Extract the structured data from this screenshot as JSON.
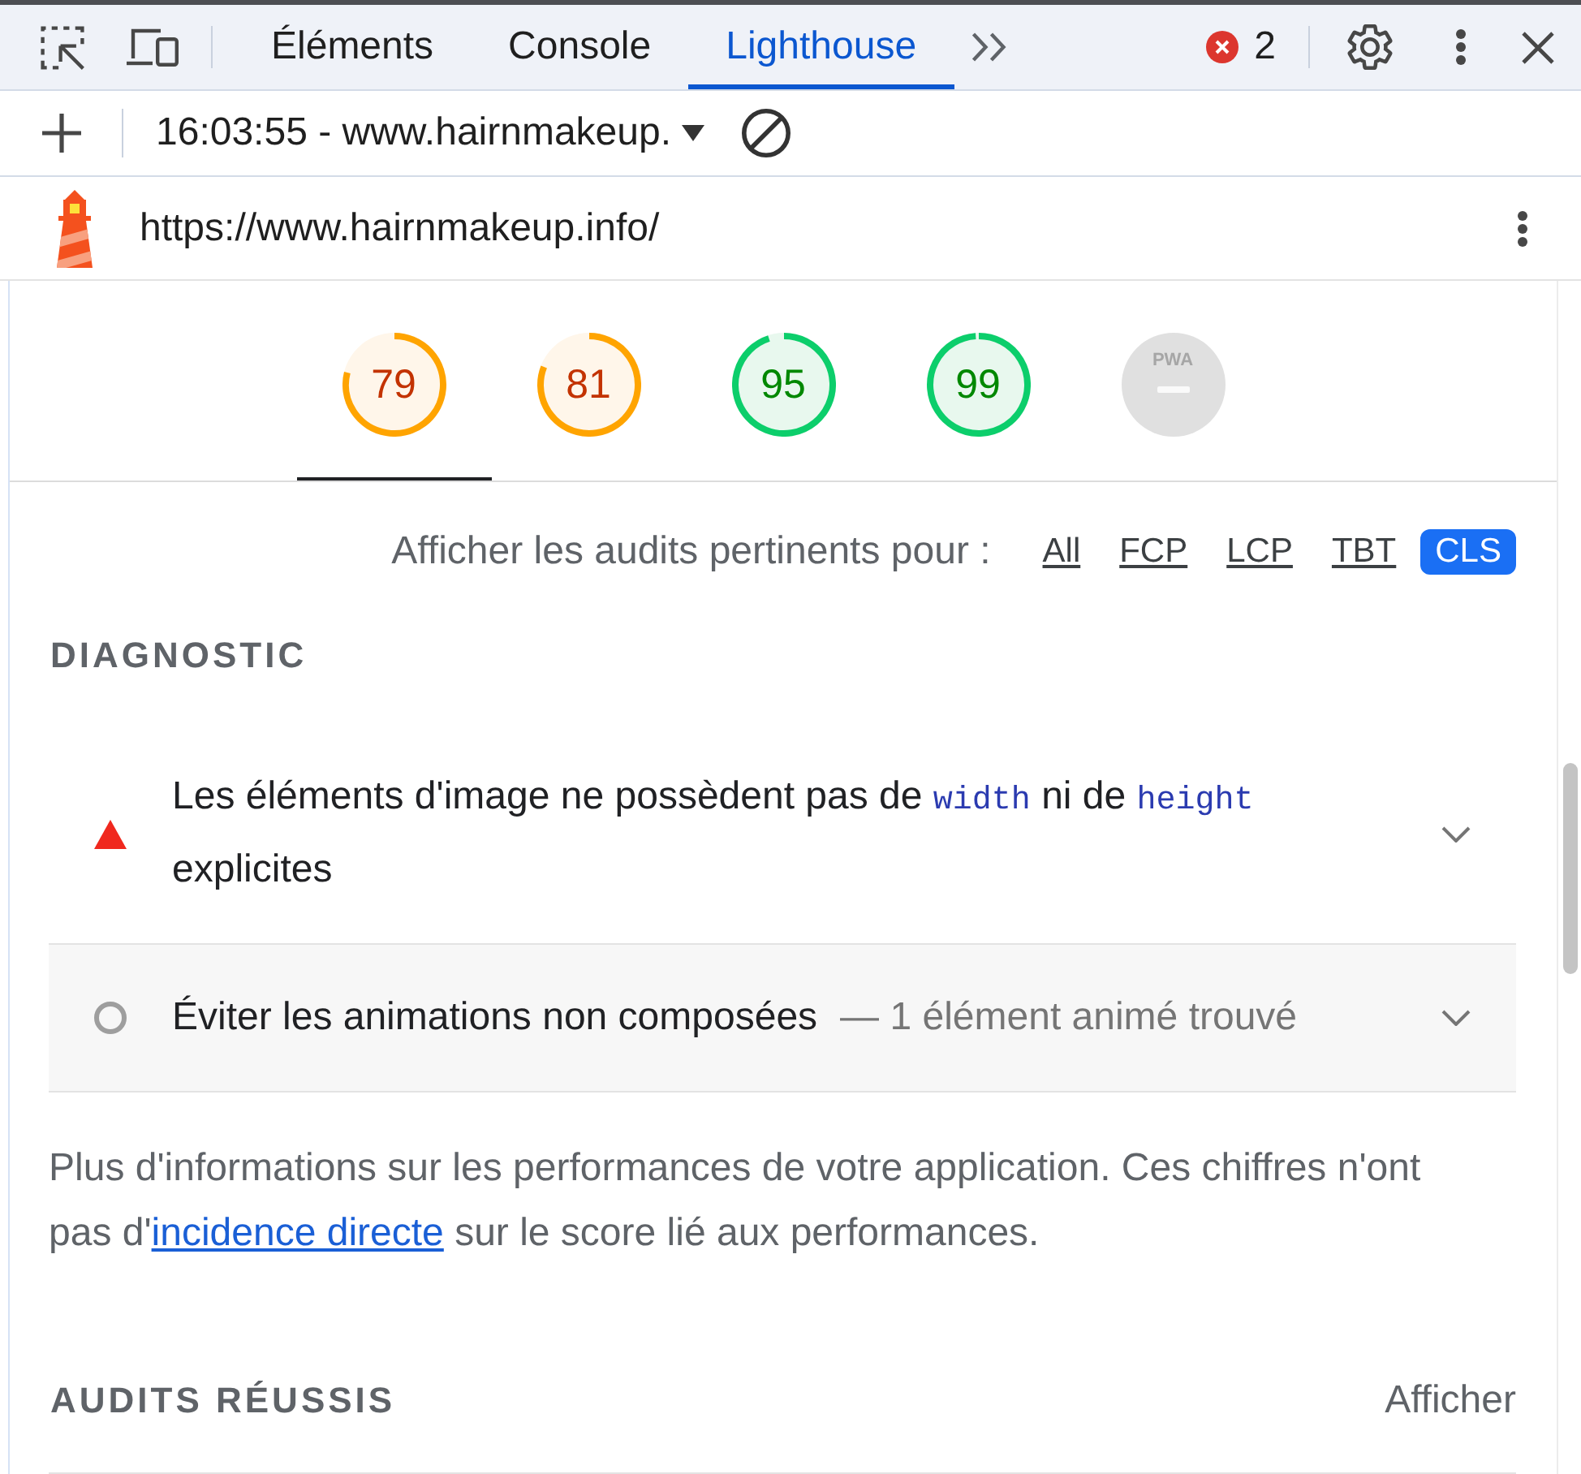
{
  "tab_bar": {
    "tabs": [
      {
        "label": "Éléments",
        "selected": false
      },
      {
        "label": "Console",
        "selected": false
      },
      {
        "label": "Lighthouse",
        "selected": true
      }
    ],
    "error_count": "2"
  },
  "report_bar": {
    "report": "16:03:55 - www.hairnmakeup."
  },
  "url_bar": {
    "url": "https://www.hairnmakeup.info/"
  },
  "gauges": [
    {
      "kind": "score",
      "score": "79",
      "selected": true
    },
    {
      "kind": "score",
      "score": "81",
      "selected": false
    },
    {
      "kind": "score",
      "score": "95",
      "selected": false
    },
    {
      "kind": "score",
      "score": "99",
      "selected": false
    },
    {
      "kind": "pwa",
      "label": "PWA",
      "selected": false
    }
  ],
  "filter": {
    "label": "Afficher les audits pertinents pour :",
    "options": [
      {
        "label": "All",
        "selected": false
      },
      {
        "label": "FCP",
        "selected": false
      },
      {
        "label": "LCP",
        "selected": false
      },
      {
        "label": "TBT",
        "selected": false
      },
      {
        "label": "CLS",
        "selected": true
      }
    ]
  },
  "diagnostic": {
    "title": "DIAGNOSTIC",
    "audits": [
      {
        "kind": "fail",
        "title": [
          {
            "kind": "text",
            "text": "Les éléments d'image ne possèdent pas de "
          },
          {
            "kind": "code",
            "text": "width"
          },
          {
            "kind": "text",
            "text": " ni de "
          },
          {
            "kind": "code",
            "text": "height"
          },
          {
            "kind": "text",
            "text": " explicites"
          }
        ],
        "expanded": false
      },
      {
        "kind": "informative",
        "title": [
          {
            "kind": "text",
            "text": "Éviter les animations non composées"
          }
        ],
        "display_value": "— 1 élément animé trouvé",
        "expanded": false
      }
    ],
    "description": {
      "text_before": "Plus d'informations sur les performances de votre application. Ces chiffres n'ont pas d'",
      "link": "incidence directe",
      "text_after": " sur le score lié aux performances."
    }
  },
  "passed": {
    "title": "AUDITS RÉUSSIS",
    "toggle": "Afficher"
  }
}
